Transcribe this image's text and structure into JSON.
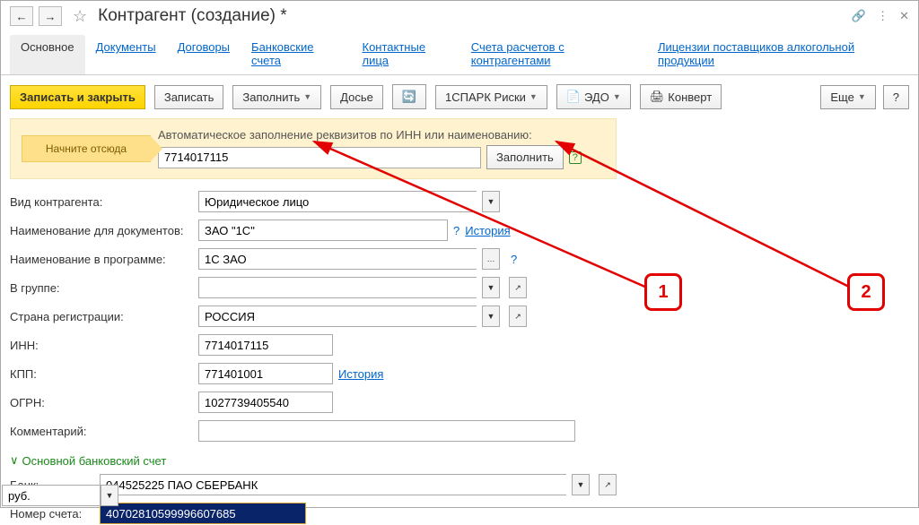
{
  "title": "Контрагент (создание) *",
  "tabs": [
    "Основное",
    "Документы",
    "Договоры",
    "Банковские счета",
    "Контактные лица",
    "Счета расчетов с контрагентами",
    "Лицензии поставщиков алкогольной продукции"
  ],
  "toolbar": {
    "save_close": "Записать и закрыть",
    "save": "Записать",
    "fill": "Заполнить",
    "dossier": "Досье",
    "spark": "1СПАРК Риски",
    "edo": "ЭДО",
    "envelope": "Конверт",
    "more": "Еще",
    "help": "?"
  },
  "autofill": {
    "start_here": "Начните отсюда",
    "hint": "Автоматическое заполнение реквизитов по ИНН или наименованию:",
    "value": "7714017115",
    "fill_btn": "Заполнить",
    "q": "?"
  },
  "fields": {
    "type_label": "Вид контрагента:",
    "type_value": "Юридическое лицо",
    "doc_name_label": "Наименование для документов:",
    "doc_name_value": "ЗАО \"1С\"",
    "history": "История",
    "prog_name_label": "Наименование в программе:",
    "prog_name_value": "1С ЗАО",
    "group_label": "В группе:",
    "group_value": "",
    "country_label": "Страна регистрации:",
    "country_value": "РОССИЯ",
    "inn_label": "ИНН:",
    "inn_value": "7714017115",
    "kpp_label": "КПП:",
    "kpp_value": "771401001",
    "ogrn_label": "ОГРН:",
    "ogrn_value": "1027739405540",
    "comment_label": "Комментарий:",
    "comment_value": ""
  },
  "bank_section": {
    "header": "Основной банковский счет",
    "bank_label": "Банк:",
    "bank_value": "044525225 ПАО СБЕРБАНК",
    "account_label": "Номер счета:",
    "account_value": "40702810599996607685",
    "currency": "руб."
  },
  "markers": {
    "m1": "1",
    "m2": "2"
  }
}
